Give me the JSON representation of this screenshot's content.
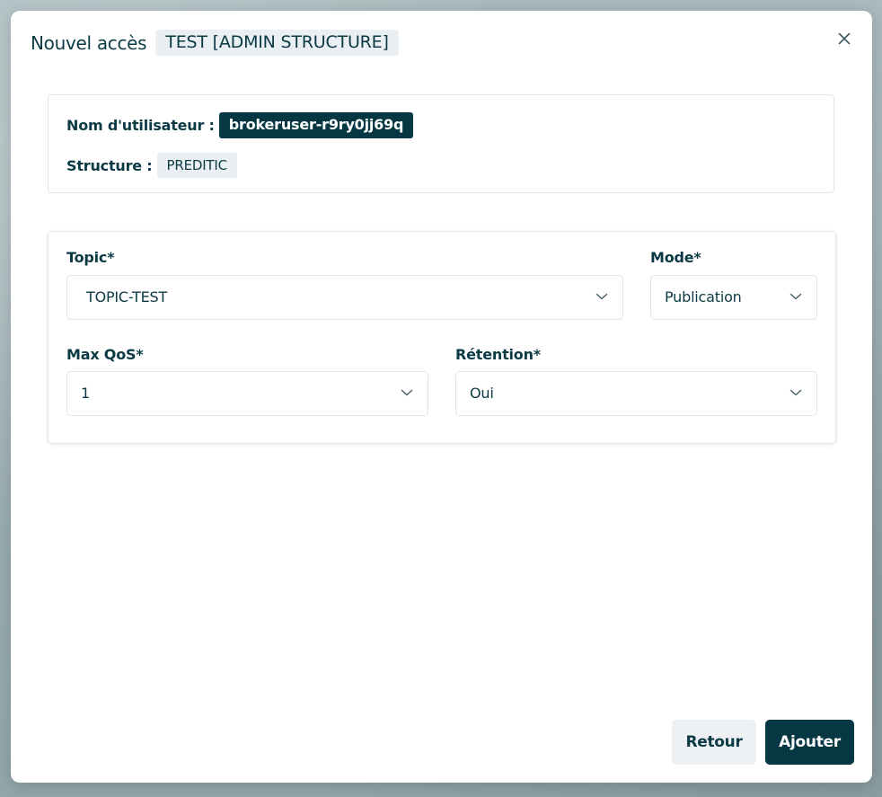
{
  "dialog": {
    "title": "Nouvel accès",
    "tag": "TEST [ADMIN STRUCTURE]"
  },
  "info": {
    "username_label": "Nom d'utilisateur :",
    "username_value": "brokeruser-r9ry0jj69q",
    "structure_label": "Structure :",
    "structure_value": "PREDITIC"
  },
  "form": {
    "topic": {
      "label": "Topic*",
      "value": "TOPIC-TEST"
    },
    "mode": {
      "label": "Mode*",
      "value": "Publication"
    },
    "max_qos": {
      "label": "Max QoS*",
      "value": "1"
    },
    "retention": {
      "label": "Rétention*",
      "value": "Oui"
    }
  },
  "actions": {
    "back_label": "Retour",
    "add_label": "Ajouter"
  },
  "colors": {
    "primary": "#063844",
    "text": "#0b3a45",
    "tag_bg": "#e9eff2",
    "border": "#e3e8eb"
  },
  "icons": {
    "close": "close-icon",
    "dropdown": "chevron-down-icon"
  }
}
